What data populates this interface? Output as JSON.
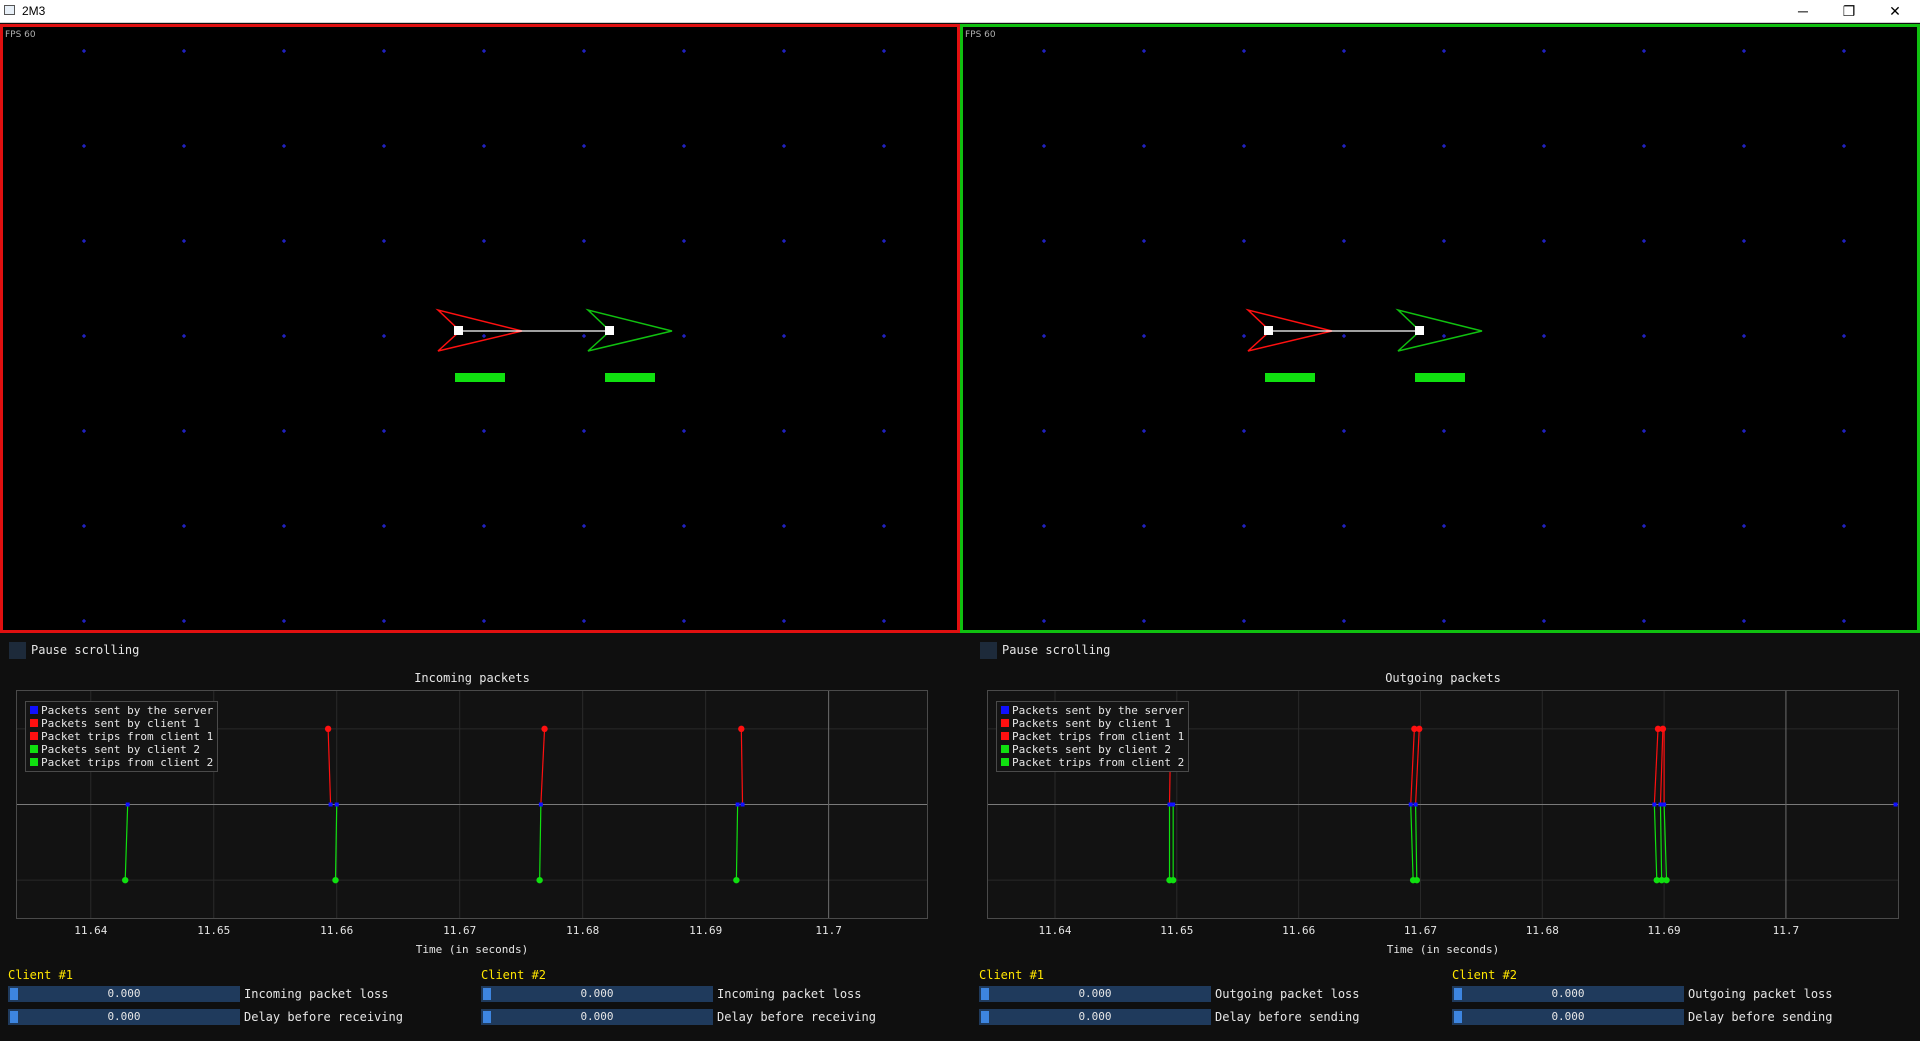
{
  "window": {
    "title": "2M3",
    "minimize_glyph": "─",
    "maximize_glyph": "❐",
    "close_glyph": "✕"
  },
  "fps_label": "FPS 60",
  "panels": [
    {
      "border_color": "#e01010",
      "pause_label": "Pause scrolling",
      "plot_title": "Incoming packets",
      "x_axis_label": "Time (in seconds)",
      "clients": [
        {
          "header": "Client #1",
          "loss_value": "0.000",
          "loss_label": "Incoming packet loss",
          "delay_value": "0.000",
          "delay_label": "Delay before receiving"
        },
        {
          "header": "Client #2",
          "loss_value": "0.000",
          "loss_label": "Incoming packet loss",
          "delay_value": "0.000",
          "delay_label": "Delay before receiving"
        }
      ]
    },
    {
      "border_color": "#10c010",
      "pause_label": "Pause scrolling",
      "plot_title": "Outgoing packets",
      "x_axis_label": "Time (in seconds)",
      "clients": [
        {
          "header": "Client #1",
          "loss_value": "0.000",
          "loss_label": "Outgoing packet loss",
          "delay_value": "0.000",
          "delay_label": "Delay before sending"
        },
        {
          "header": "Client #2",
          "loss_value": "0.000",
          "loss_label": "Outgoing packet loss",
          "delay_value": "0.000",
          "delay_label": "Delay before sending"
        }
      ]
    }
  ],
  "legend": [
    {
      "label": "Packets sent by the server",
      "color": "#1010ff"
    },
    {
      "label": "Packets sent by client 1",
      "color": "#ff1010"
    },
    {
      "label": "Packet trips from client 1",
      "color": "#ff1010"
    },
    {
      "label": "Packets sent by client 2",
      "color": "#10e010"
    },
    {
      "label": "Packet trips from client 2",
      "color": "#10e010"
    }
  ],
  "x_ticks": [
    "11.64",
    "11.65",
    "11.66",
    "11.67",
    "11.68",
    "11.69",
    "11.7"
  ],
  "chart_data": [
    {
      "type": "scatter",
      "title": "Incoming packets",
      "xlabel": "Time (in seconds)",
      "xlim": [
        11.634,
        11.708
      ],
      "ylim": [
        -1.5,
        1.5
      ],
      "series": [
        {
          "name": "Packets sent by the server",
          "x": [
            11.643,
            11.6595,
            11.66,
            11.6766,
            11.6926,
            11.693
          ],
          "y": [
            0,
            0,
            0,
            0,
            0,
            0
          ]
        },
        {
          "name": "Packet trips from client 1",
          "trips": [
            [
              11.6593,
              11.6595
            ],
            [
              11.6769,
              11.6766
            ],
            [
              11.6929,
              11.693
            ]
          ]
        },
        {
          "name": "Packets sent by client 1",
          "x": [
            11.6593,
            11.6769,
            11.6929
          ],
          "y": [
            1,
            1,
            1
          ]
        },
        {
          "name": "Packet trips from client 2",
          "trips": [
            [
              11.6428,
              11.643
            ],
            [
              11.6599,
              11.66
            ],
            [
              11.6765,
              11.6766
            ],
            [
              11.6925,
              11.6926
            ]
          ]
        },
        {
          "name": "Packets sent by client 2",
          "x": [
            11.6428,
            11.6599,
            11.6765,
            11.6925
          ],
          "y": [
            -1,
            -1,
            -1,
            -1
          ]
        }
      ]
    },
    {
      "type": "scatter",
      "title": "Outgoing packets",
      "xlabel": "Time (in seconds)",
      "xlim": [
        11.6345,
        11.7092
      ],
      "ylim": [
        -1.5,
        1.5
      ],
      "series": [
        {
          "name": "Packets sent by the server",
          "x": [
            11.6494,
            11.6497,
            11.6692,
            11.6696,
            11.6892,
            11.6897,
            11.69,
            11.709
          ],
          "y": [
            0,
            0,
            0,
            0,
            0,
            0,
            0,
            0
          ]
        },
        {
          "name": "Packet trips from client 1",
          "trips": [
            [
              11.6495,
              11.6494
            ],
            [
              11.6695,
              11.6692
            ],
            [
              11.6699,
              11.6696
            ],
            [
              11.6895,
              11.6892
            ],
            [
              11.6899,
              11.6897
            ],
            [
              11.69,
              11.69
            ]
          ]
        },
        {
          "name": "Packets sent by client 1",
          "x": [
            11.6495,
            11.6695,
            11.6699,
            11.6895,
            11.6899
          ],
          "y": [
            1,
            1,
            1,
            1,
            1
          ]
        },
        {
          "name": "Packet trips from client 2",
          "trips": [
            [
              11.6494,
              11.6494
            ],
            [
              11.6497,
              11.6497
            ],
            [
              11.6694,
              11.6692
            ],
            [
              11.6697,
              11.6696
            ],
            [
              11.6894,
              11.6892
            ],
            [
              11.6898,
              11.6897
            ],
            [
              11.6902,
              11.69
            ]
          ]
        },
        {
          "name": "Packets sent by client 2",
          "x": [
            11.6494,
            11.6497,
            11.6694,
            11.6697,
            11.6894,
            11.6898,
            11.6902
          ],
          "y": [
            -1,
            -1,
            -1,
            -1,
            -1,
            -1,
            -1
          ]
        }
      ]
    }
  ]
}
